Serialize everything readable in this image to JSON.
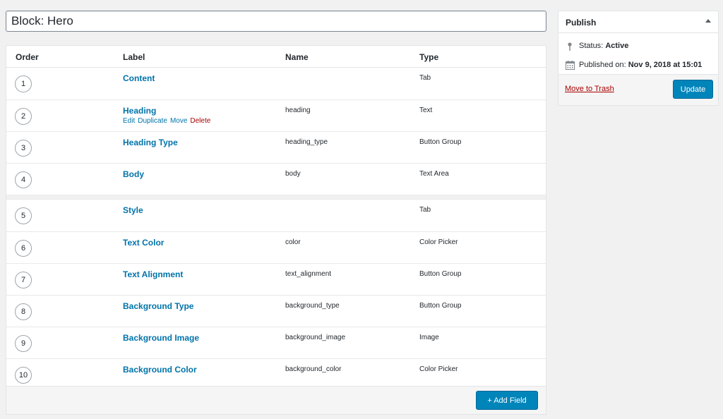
{
  "post_title": "Block: Hero",
  "fields_table": {
    "columns": {
      "order": "Order",
      "label": "Label",
      "name": "Name",
      "type": "Type"
    },
    "groups": [
      [
        {
          "order": "1",
          "label": "Content",
          "name": "",
          "type": "Tab"
        },
        {
          "order": "2",
          "label": "Heading",
          "name": "heading",
          "type": "Text",
          "hover": true
        },
        {
          "order": "3",
          "label": "Heading Type",
          "name": "heading_type",
          "type": "Button Group"
        },
        {
          "order": "4",
          "label": "Body",
          "name": "body",
          "type": "Text Area"
        }
      ],
      [
        {
          "order": "5",
          "label": "Style",
          "name": "",
          "type": "Tab"
        },
        {
          "order": "6",
          "label": "Text Color",
          "name": "color",
          "type": "Color Picker"
        },
        {
          "order": "7",
          "label": "Text Alignment",
          "name": "text_alignment",
          "type": "Button Group"
        },
        {
          "order": "8",
          "label": "Background Type",
          "name": "background_type",
          "type": "Button Group"
        },
        {
          "order": "9",
          "label": "Background Image",
          "name": "background_image",
          "type": "Image"
        },
        {
          "order": "10",
          "label": "Background Color",
          "name": "background_color",
          "type": "Color Picker"
        }
      ]
    ],
    "row_actions": {
      "edit": "Edit",
      "duplicate": "Duplicate",
      "move": "Move",
      "delete": "Delete"
    },
    "add_field_label": "+ Add Field"
  },
  "publish": {
    "title": "Publish",
    "status_label": "Status:",
    "status_value": "Active",
    "published_label": "Published on:",
    "published_value": "Nov 9, 2018 at 15:01",
    "trash_label": "Move to Trash",
    "update_label": "Update"
  },
  "colors": {
    "link": "#0073aa",
    "primary_button": "#0085ba",
    "danger": "#aa0000"
  },
  "icons": {
    "status": "pin-icon",
    "date": "calendar-icon",
    "collapse": "triangle-up-icon"
  }
}
